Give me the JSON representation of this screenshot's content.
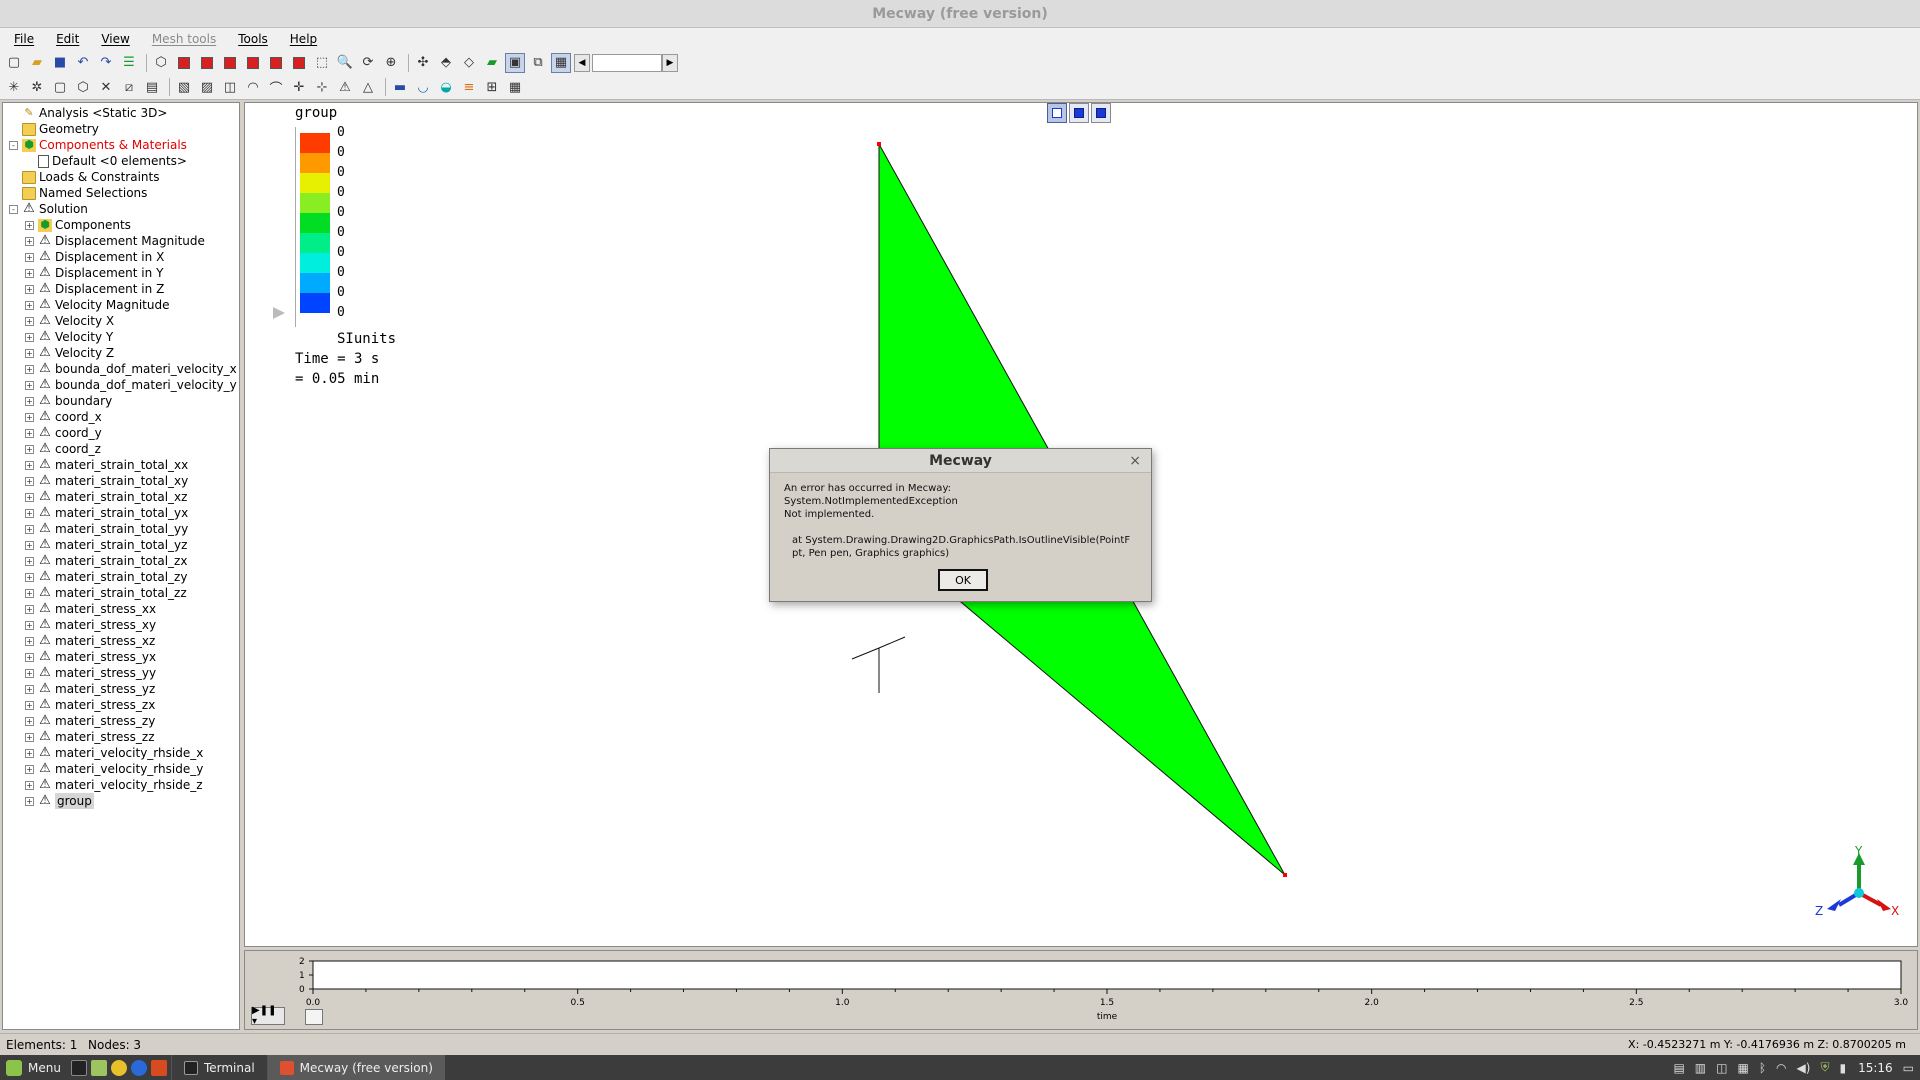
{
  "window": {
    "title": "Mecway (free version)"
  },
  "menu": [
    {
      "label": "File",
      "disabled": false
    },
    {
      "label": "Edit",
      "disabled": false
    },
    {
      "label": "View",
      "disabled": false
    },
    {
      "label": "Mesh tools",
      "disabled": true
    },
    {
      "label": "Tools",
      "disabled": false
    },
    {
      "label": "Help",
      "disabled": false
    }
  ],
  "tree": [
    {
      "label": "Analysis <Static 3D>",
      "level": 0,
      "expander": "",
      "icon": "analysis-icon"
    },
    {
      "label": "Geometry",
      "level": 0,
      "expander": "",
      "icon": "folder-icon"
    },
    {
      "label": "Components & Materials",
      "level": 0,
      "expander": "-",
      "icon": "components-icon",
      "red": true
    },
    {
      "label": "Default <0 elements>",
      "level": 1,
      "expander": "",
      "icon": "material-icon"
    },
    {
      "label": "Loads & Constraints",
      "level": 0,
      "expander": "",
      "icon": "folder-icon"
    },
    {
      "label": "Named Selections",
      "level": 0,
      "expander": "",
      "icon": "folder-icon"
    },
    {
      "label": "Solution",
      "level": 0,
      "expander": "-",
      "icon": "warning-icon"
    },
    {
      "label": "Components",
      "level": 1,
      "expander": "+",
      "icon": "components-icon"
    },
    {
      "label": "Displacement Magnitude",
      "level": 1,
      "expander": "+",
      "icon": "warning-icon"
    },
    {
      "label": "Displacement in X",
      "level": 1,
      "expander": "+",
      "icon": "warning-icon"
    },
    {
      "label": "Displacement in Y",
      "level": 1,
      "expander": "+",
      "icon": "warning-icon"
    },
    {
      "label": "Displacement in Z",
      "level": 1,
      "expander": "+",
      "icon": "warning-icon"
    },
    {
      "label": "Velocity Magnitude",
      "level": 1,
      "expander": "+",
      "icon": "warning-icon"
    },
    {
      "label": "Velocity X",
      "level": 1,
      "expander": "+",
      "icon": "warning-icon"
    },
    {
      "label": "Velocity Y",
      "level": 1,
      "expander": "+",
      "icon": "warning-icon"
    },
    {
      "label": "Velocity Z",
      "level": 1,
      "expander": "+",
      "icon": "warning-icon"
    },
    {
      "label": "bounda_dof_materi_velocity_x",
      "level": 1,
      "expander": "+",
      "icon": "warning-icon"
    },
    {
      "label": "bounda_dof_materi_velocity_y",
      "level": 1,
      "expander": "+",
      "icon": "warning-icon"
    },
    {
      "label": "boundary",
      "level": 1,
      "expander": "+",
      "icon": "warning-icon"
    },
    {
      "label": "coord_x",
      "level": 1,
      "expander": "+",
      "icon": "warning-icon"
    },
    {
      "label": "coord_y",
      "level": 1,
      "expander": "+",
      "icon": "warning-icon"
    },
    {
      "label": "coord_z",
      "level": 1,
      "expander": "+",
      "icon": "warning-icon"
    },
    {
      "label": "materi_strain_total_xx",
      "level": 1,
      "expander": "+",
      "icon": "warning-icon"
    },
    {
      "label": "materi_strain_total_xy",
      "level": 1,
      "expander": "+",
      "icon": "warning-icon"
    },
    {
      "label": "materi_strain_total_xz",
      "level": 1,
      "expander": "+",
      "icon": "warning-icon"
    },
    {
      "label": "materi_strain_total_yx",
      "level": 1,
      "expander": "+",
      "icon": "warning-icon"
    },
    {
      "label": "materi_strain_total_yy",
      "level": 1,
      "expander": "+",
      "icon": "warning-icon"
    },
    {
      "label": "materi_strain_total_yz",
      "level": 1,
      "expander": "+",
      "icon": "warning-icon"
    },
    {
      "label": "materi_strain_total_zx",
      "level": 1,
      "expander": "+",
      "icon": "warning-icon"
    },
    {
      "label": "materi_strain_total_zy",
      "level": 1,
      "expander": "+",
      "icon": "warning-icon"
    },
    {
      "label": "materi_strain_total_zz",
      "level": 1,
      "expander": "+",
      "icon": "warning-icon"
    },
    {
      "label": "materi_stress_xx",
      "level": 1,
      "expander": "+",
      "icon": "warning-icon"
    },
    {
      "label": "materi_stress_xy",
      "level": 1,
      "expander": "+",
      "icon": "warning-icon"
    },
    {
      "label": "materi_stress_xz",
      "level": 1,
      "expander": "+",
      "icon": "warning-icon"
    },
    {
      "label": "materi_stress_yx",
      "level": 1,
      "expander": "+",
      "icon": "warning-icon"
    },
    {
      "label": "materi_stress_yy",
      "level": 1,
      "expander": "+",
      "icon": "warning-icon"
    },
    {
      "label": "materi_stress_yz",
      "level": 1,
      "expander": "+",
      "icon": "warning-icon"
    },
    {
      "label": "materi_stress_zx",
      "level": 1,
      "expander": "+",
      "icon": "warning-icon"
    },
    {
      "label": "materi_stress_zy",
      "level": 1,
      "expander": "+",
      "icon": "warning-icon"
    },
    {
      "label": "materi_stress_zz",
      "level": 1,
      "expander": "+",
      "icon": "warning-icon"
    },
    {
      "label": "materi_velocity_rhside_x",
      "level": 1,
      "expander": "+",
      "icon": "warning-icon"
    },
    {
      "label": "materi_velocity_rhside_y",
      "level": 1,
      "expander": "+",
      "icon": "warning-icon"
    },
    {
      "label": "materi_velocity_rhside_z",
      "level": 1,
      "expander": "+",
      "icon": "warning-icon"
    },
    {
      "label": "group",
      "level": 1,
      "expander": "+",
      "icon": "warning-icon",
      "selected": true
    }
  ],
  "legend": {
    "title": "group",
    "values": [
      "0",
      "0",
      "0",
      "0",
      "0",
      "0",
      "0",
      "0",
      "0",
      "0"
    ],
    "colors": [
      "#ff3c00",
      "#ff9900",
      "#e6f000",
      "#88ee22",
      "#00dd22",
      "#00ee88",
      "#00eedd",
      "#00aaff",
      "#0044ff"
    ],
    "units": "SIunits",
    "time_line1": "Time = 3 s",
    "time_line2": "= 0.05 min"
  },
  "model": {
    "fill_color": "#00ff00",
    "node_color": "#ff0000"
  },
  "triad": {
    "x": "X",
    "y": "Y",
    "z": "Z"
  },
  "dialog": {
    "title": "Mecway",
    "close": "×",
    "line1": "An error has occurred in Mecway:",
    "line2": "System.NotImplementedException",
    "line3": "Not implemented.",
    "line4": "at System.Drawing.Drawing2D.GraphicsPath.IsOutlineVisible(PointF pt, Pen pen, Graphics graphics)",
    "ok_label": "OK"
  },
  "timeline": {
    "y_ticks": [
      "2",
      "1",
      "0"
    ],
    "x_ticks": [
      "0.0",
      "0.5",
      "1.0",
      "1.5",
      "2.0",
      "2.5",
      "3.0"
    ],
    "xlabel": "time"
  },
  "status": {
    "elements": "Elements: 1",
    "nodes": "Nodes: 3",
    "coords": "X: -0.4523271 m Y: -0.4176936 m Z: 0.8700205 m"
  },
  "taskbar": {
    "menu_label": "Menu",
    "tasks": [
      {
        "label": "Terminal",
        "active": false
      },
      {
        "label": "Mecway (free version)",
        "active": true
      }
    ],
    "clock": "15:16"
  }
}
